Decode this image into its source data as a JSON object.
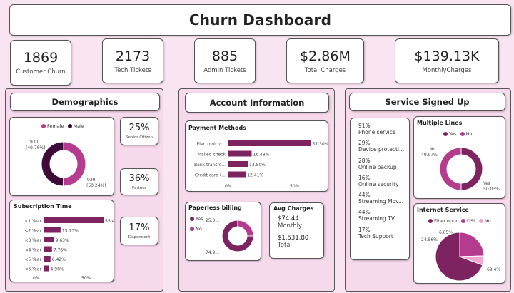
{
  "title": "Churn Dashboard",
  "kpis": [
    {
      "value": "1869",
      "label": "Customer Churn"
    },
    {
      "value": "2173",
      "label": "Tech Tickets"
    },
    {
      "value": "885",
      "label": "Admin Tickets"
    },
    {
      "value": "$2.86M",
      "label": "Total Charges"
    },
    {
      "value": "$139.13K",
      "label": "MonthlyCharges"
    }
  ],
  "sections": {
    "demographics": "Demographics",
    "account": "Account Information",
    "service": "Service Signed Up"
  },
  "colors": {
    "dark": "#3d0c3a",
    "primary": "#7c2360",
    "medium": "#b43b8e",
    "light": "#f2a6cf",
    "panel": "#f7d9ec",
    "background": "#f9e4f1"
  },
  "stats": [
    {
      "value": "25%",
      "label": "Senior Citizen"
    },
    {
      "value": "36%",
      "label": "Partner"
    },
    {
      "value": "17%",
      "label": "Dependent"
    }
  ],
  "gender": {
    "legend": [
      {
        "label": "Female",
        "color": "#b43b8e"
      },
      {
        "label": "Male",
        "color": "#3d0c3a"
      }
    ],
    "labels": {
      "male_count": "930",
      "male_pct": "(49.76%)",
      "female_count": "939",
      "female_pct": "(50.24%)"
    }
  },
  "subscription": {
    "title": "Subscription Time",
    "axis_min": "0%",
    "axis_mid": "50%"
  },
  "payment": {
    "title": "Payment Methods",
    "axis_min": "0%",
    "axis_mid": "50%"
  },
  "paperless": {
    "title": "Paperless billing",
    "legend": [
      {
        "label": "Yes",
        "color": "#7c2360"
      },
      {
        "label": "No",
        "color": "#b43b8e"
      }
    ],
    "labels": {
      "top": "25.0...",
      "bottom": "74.9..."
    }
  },
  "avg_charges": {
    "title": "Avg Charges",
    "monthly_value": "$74.44",
    "monthly_label": "Monthly",
    "total_value": "$1,531.80",
    "total_label": "Total"
  },
  "services": [
    {
      "pct": "91%",
      "name": "Phone service"
    },
    {
      "pct": "29%",
      "name": "Device protecti..."
    },
    {
      "pct": "28%",
      "name": "Online backup"
    },
    {
      "pct": "16%",
      "name": "Online security"
    },
    {
      "pct": "44%",
      "name": "Streaming Mov..."
    },
    {
      "pct": "44%",
      "name": "Streaming TV"
    },
    {
      "pct": "17%",
      "name": "Tech Support"
    }
  ],
  "multiple_lines": {
    "title": "Multiple Lines",
    "legend": [
      {
        "label": "Yes",
        "color": "#7c2360"
      },
      {
        "label": "No",
        "color": "#b43b8e"
      }
    ],
    "labels": {
      "no_label": "No",
      "no_pct": "49.97%",
      "yes_label": "Yes",
      "yes_pct": "50.03%"
    }
  },
  "internet": {
    "title": "Internet Service",
    "legend": [
      {
        "label": "Fiber optic",
        "color": "#7c2360"
      },
      {
        "label": "DSL",
        "color": "#b43b8e"
      },
      {
        "label": "No",
        "color": "#f2a6cf"
      }
    ],
    "labels": {
      "no_pct": "6.05%",
      "dsl_pct": "24.56%",
      "fiber_pct": "69.4%"
    }
  },
  "chart_data": [
    {
      "type": "pie",
      "categories": [
        "Female",
        "Male"
      ],
      "values": [
        50.24,
        49.76
      ],
      "counts": [
        939,
        930
      ]
    },
    {
      "type": "bar",
      "title": "Subscription Time",
      "categories": [
        "<1 Year",
        "<2 Year",
        "<3 Year",
        "<4 Year",
        "<5 Year",
        "<6 Year"
      ],
      "values": [
        55.48,
        15.73,
        9.63,
        7.76,
        6.42,
        4.98
      ],
      "labels": [
        "55.48%",
        "15.73%",
        "9.63%",
        "7.76%",
        "6.42%",
        "4.98%"
      ],
      "xlim": [
        0,
        60
      ]
    },
    {
      "type": "bar",
      "title": "Payment Methods",
      "categories": [
        "Electronic c...",
        "Mailed check",
        "Bank transfe...",
        "Credit card (..."
      ],
      "values": [
        57.3,
        16.48,
        13.8,
        12.41
      ],
      "labels": [
        "57.30%",
        "16.48%",
        "13.80%",
        "12.41%"
      ],
      "xlim": [
        0,
        60
      ]
    },
    {
      "type": "pie",
      "title": "Paperless billing",
      "categories": [
        "Yes",
        "No"
      ],
      "values": [
        74.9,
        25.0
      ]
    },
    {
      "type": "pie",
      "title": "Multiple Lines",
      "categories": [
        "Yes",
        "No"
      ],
      "values": [
        50.03,
        49.97
      ]
    },
    {
      "type": "pie",
      "title": "Internet Service",
      "categories": [
        "Fiber optic",
        "DSL",
        "No"
      ],
      "values": [
        69.4,
        24.56,
        6.05
      ]
    }
  ]
}
